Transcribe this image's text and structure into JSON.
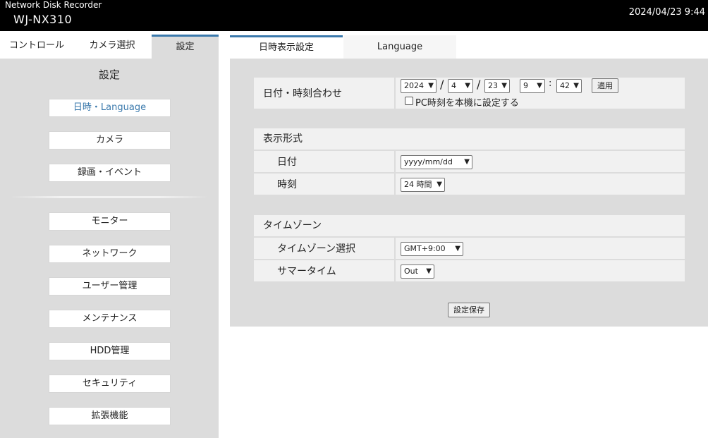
{
  "header": {
    "subtitle": "Network Disk Recorder",
    "model": "WJ-NX310",
    "datetime": "2024/04/23 9:44"
  },
  "left_tabs": [
    "コントロール",
    "カメラ選択",
    "設定"
  ],
  "sidebar": {
    "title": "設定",
    "items": [
      "日時・Language",
      "カメラ",
      "録画・イベント",
      "モニター",
      "ネットワーク",
      "ユーザー管理",
      "メンテナンス",
      "HDD管理",
      "セキュリティ",
      "拡張機能"
    ]
  },
  "right_tabs": [
    "日時表示設定",
    "Language"
  ],
  "datetime_adjust": {
    "label": "日付・時刻合わせ",
    "year": "2024",
    "month": "4",
    "day": "23",
    "hour": "9",
    "minute": "42",
    "separator_slash": "/",
    "separator_colon": ":",
    "apply_label": "適用",
    "pc_time_label": "PC時刻を本機に設定する"
  },
  "display_format": {
    "heading": "表示形式",
    "date_label": "日付",
    "date_value": "yyyy/mm/dd",
    "time_label": "時刻",
    "time_value": "24 時間"
  },
  "timezone": {
    "heading": "タイムゾーン",
    "zone_label": "タイムゾーン選択",
    "zone_value": "GMT+9:00",
    "dst_label": "サマータイム",
    "dst_value": "Out"
  },
  "save_label": "設定保存",
  "icons": {
    "dropdown": "chevron-down-icon"
  },
  "colors": {
    "accent": "#3a79ac",
    "header_bg": "#000000",
    "panel_bg": "#dcdcdc"
  }
}
